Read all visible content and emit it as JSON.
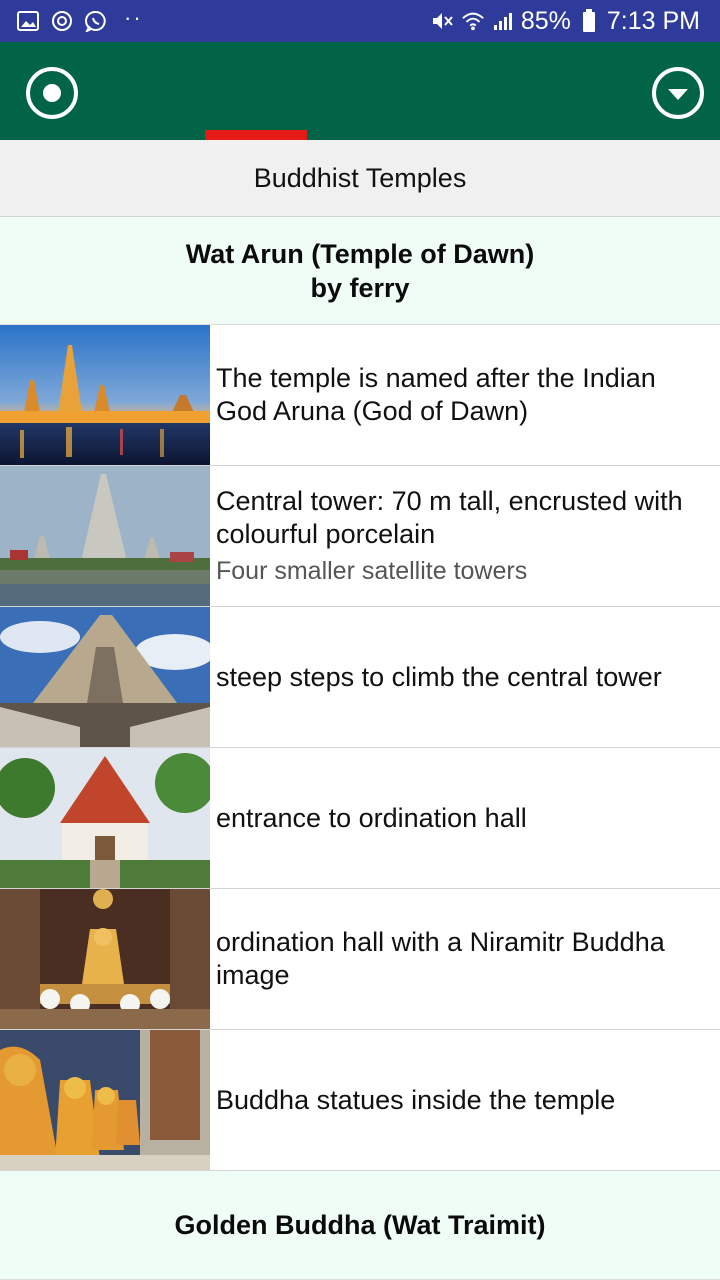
{
  "status_bar": {
    "battery": "85%",
    "time": "7:13 PM",
    "icons": [
      "gallery-icon",
      "sync-icon",
      "whatsapp-icon",
      "mute-icon",
      "wifi-icon",
      "signal-icon",
      "battery-icon"
    ]
  },
  "app_bar": {
    "left_icon": "radio-target-icon",
    "right_icon": "dropdown-circle-icon",
    "accent": "#026446",
    "indicator_color": "#e41b17"
  },
  "section": {
    "title": "Buddhist Temples"
  },
  "groups": [
    {
      "title_line1": "Wat Arun (Temple of Dawn)",
      "title_line2": "by ferry"
    },
    {
      "title_line1": "Golden Buddha (Wat Traimit)"
    }
  ],
  "items": [
    {
      "text": "The temple is named after the Indian God Aruna (God of Dawn)",
      "subtext": ""
    },
    {
      "text": "Central tower: 70 m tall, encrusted with colourful porcelain",
      "subtext": "Four smaller satellite towers"
    },
    {
      "text": "steep steps to climb the central tower",
      "subtext": ""
    },
    {
      "text": "entrance to ordination hall",
      "subtext": ""
    },
    {
      "text": "ordination hall with a Niramitr Buddha image",
      "subtext": ""
    },
    {
      "text": "Buddha statues inside the temple",
      "subtext": ""
    }
  ]
}
